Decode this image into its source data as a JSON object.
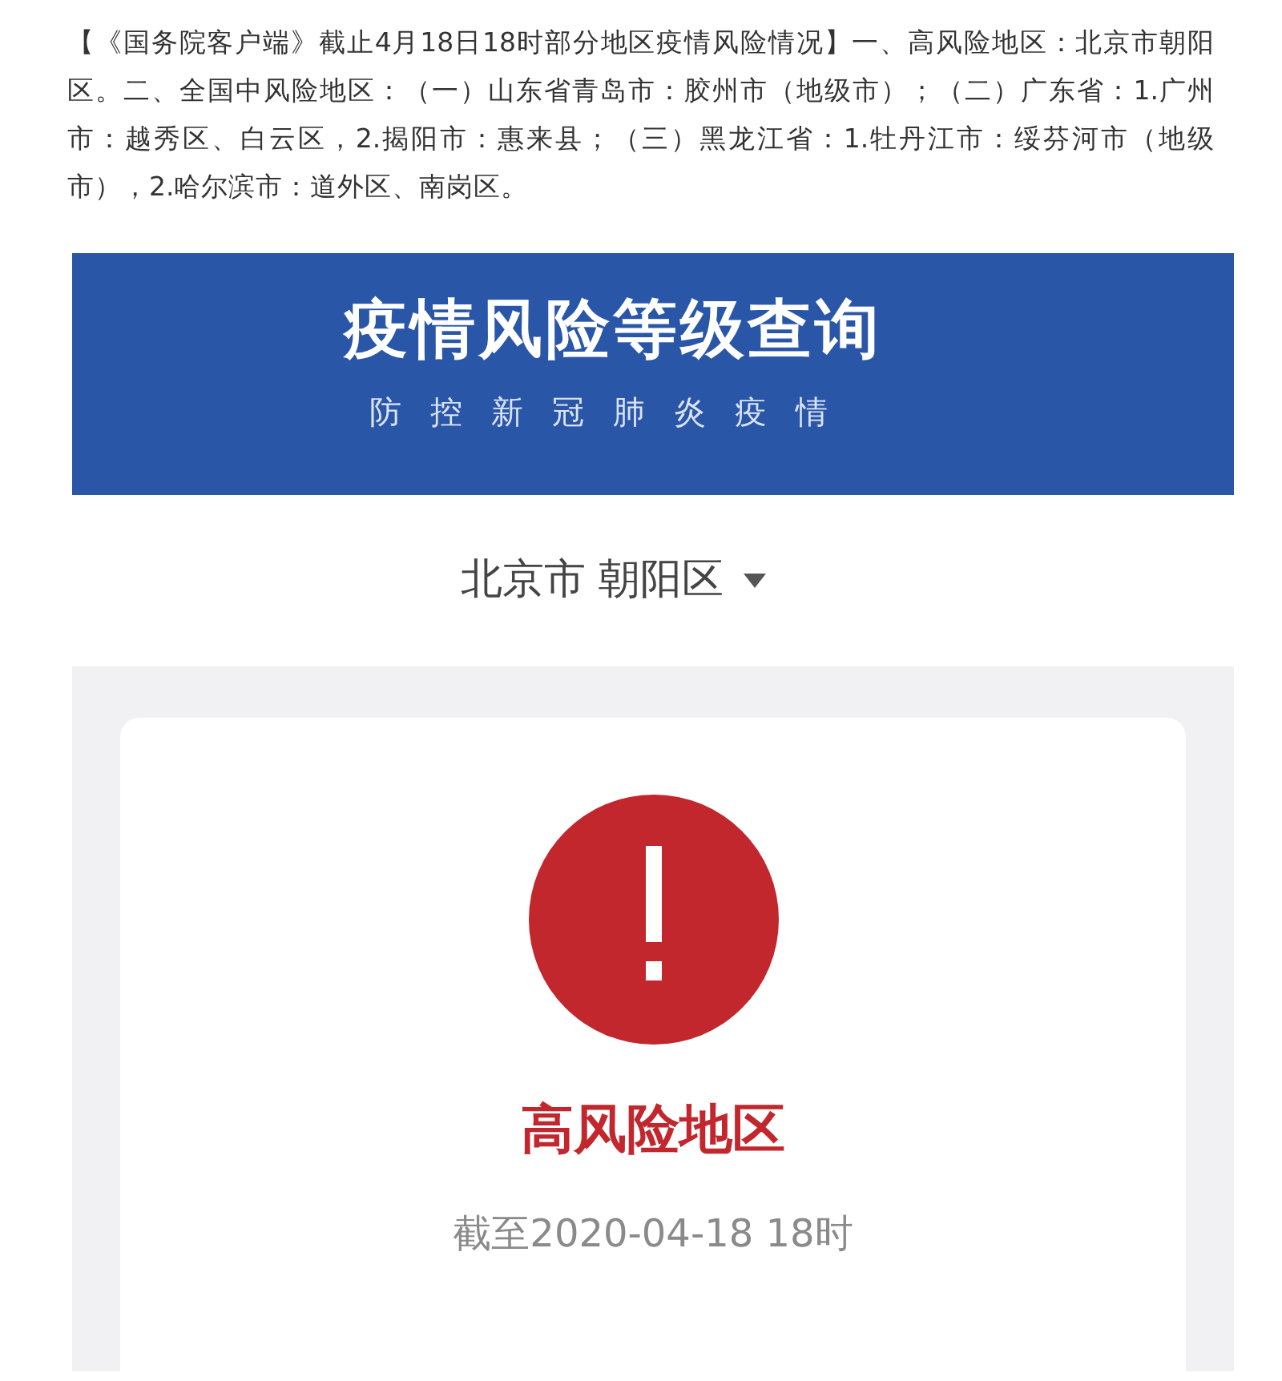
{
  "article": {
    "text": "【《国务院客户端》截止4月18日18时部分地区疫情风险情况】一、高风险地区：北京市朝阳区。二、全国中风险地区：（一）山东省青岛市：胶州市（地级市）；（二）广东省：1.广州市：越秀区、白云区，2.揭阳市：惠来县；（三）黑龙江省：1.牡丹江市：绥芬河市（地级市），2.哈尔滨市：道外区、南岗区。"
  },
  "banner": {
    "title": "疫情风险等级查询",
    "subtitle": "防控新冠肺炎疫情"
  },
  "location": {
    "value": "北京市 朝阳区"
  },
  "result": {
    "color": "#c1272d",
    "label": "高风险地区",
    "time": "截至2020-04-18 18时"
  }
}
